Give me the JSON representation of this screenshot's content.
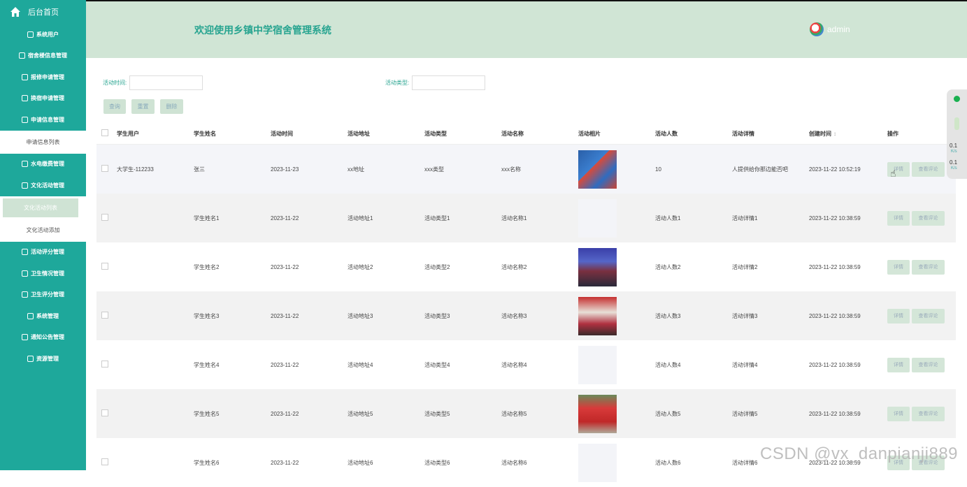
{
  "sidebar": {
    "home": "后台首页",
    "items": [
      {
        "label": "系统用户"
      },
      {
        "label": "宿舍楼信息管理"
      },
      {
        "label": "报修申请管理"
      },
      {
        "label": "换宿申请管理"
      },
      {
        "label": "申请信息管理"
      }
    ],
    "sub1": "申请信息列表",
    "items2": [
      {
        "label": "水电缴费管理"
      },
      {
        "label": "文化活动管理"
      }
    ],
    "sub_active": "文化活动列表",
    "sub_add": "文化活动添加",
    "items3": [
      {
        "label": "活动评分管理"
      },
      {
        "label": "卫生情况管理"
      },
      {
        "label": "卫生评分管理"
      },
      {
        "label": "系统管理"
      },
      {
        "label": "通知公告管理"
      },
      {
        "label": "资源管理"
      }
    ]
  },
  "header": {
    "title": "欢迎使用乡镇中学宿舍管理系统",
    "user": "admin"
  },
  "filters": {
    "time_label": "活动时间:",
    "type_label": "活动类型:",
    "time_value": "",
    "type_value": ""
  },
  "buttons": {
    "search": "查询",
    "reset": "重置",
    "delete": "删除"
  },
  "table": {
    "headers": [
      "学生用户",
      "学生姓名",
      "活动时间",
      "活动地址",
      "活动类型",
      "活动名称",
      "活动相片",
      "活动人数",
      "活动详情",
      "创建时间",
      "操作"
    ],
    "sort_icon": "↕",
    "detail_label": "详情",
    "review_label": "查看评论",
    "rows": [
      {
        "user": "大学生-112233",
        "name": "张三",
        "time": "2023-11-23",
        "addr": "xx地址",
        "type": "xxx类型",
        "title": "xxx名称",
        "photo": "court",
        "count": "10",
        "detail": "人提供给你那边能否吧",
        "created": "2023-11-22 10:52:19"
      },
      {
        "user": "",
        "name": "学生姓名1",
        "time": "2023-11-22",
        "addr": "活动地址1",
        "type": "活动类型1",
        "title": "活动名称1",
        "photo": "blank",
        "count": "活动人数1",
        "detail": "活动详情1",
        "created": "2023-11-22 10:38:59"
      },
      {
        "user": "",
        "name": "学生姓名2",
        "time": "2023-11-22",
        "addr": "活动地址2",
        "type": "活动类型2",
        "title": "活动名称2",
        "photo": "crowd",
        "count": "活动人数2",
        "detail": "活动详情2",
        "created": "2023-11-22 10:38:59"
      },
      {
        "user": "",
        "name": "学生姓名3",
        "time": "2023-11-22",
        "addr": "活动地址3",
        "type": "活动类型3",
        "title": "活动名称3",
        "photo": "people",
        "count": "活动人数3",
        "detail": "活动详情3",
        "created": "2023-11-22 10:38:59"
      },
      {
        "user": "",
        "name": "学生姓名4",
        "time": "2023-11-22",
        "addr": "活动地址4",
        "type": "活动类型4",
        "title": "活动名称4",
        "photo": "blank",
        "count": "活动人数4",
        "detail": "活动详情4",
        "created": "2023-11-22 10:38:59"
      },
      {
        "user": "",
        "name": "学生姓名5",
        "time": "2023-11-22",
        "addr": "活动地址5",
        "type": "活动类型5",
        "title": "活动名称5",
        "photo": "tent",
        "count": "活动人数5",
        "detail": "活动详情5",
        "created": "2023-11-22 10:38:59"
      },
      {
        "user": "",
        "name": "学生姓名6",
        "time": "2023-11-22",
        "addr": "活动地址6",
        "type": "活动类型6",
        "title": "活动名称6",
        "photo": "blank",
        "count": "活动人数6",
        "detail": "活动详情6",
        "created": "2023-11-22 10:38:59"
      }
    ]
  },
  "widget": {
    "up_speed": "0.1",
    "up_unit": "K/s",
    "down_speed": "0.1",
    "down_unit": "K/s"
  },
  "watermark": "CSDN @vx_danpianji889",
  "colors": {
    "sidebar": "#1ea89b",
    "header": "#d0e5d5",
    "title": "#27a490"
  }
}
